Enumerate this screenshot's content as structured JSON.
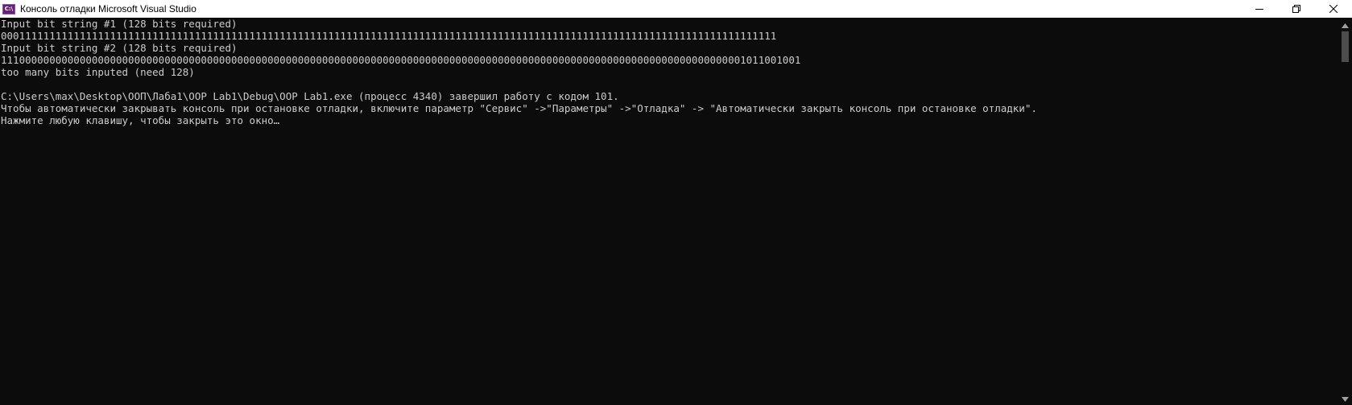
{
  "window": {
    "icon_label": "C:\\",
    "title": "Консоль отладки Microsoft Visual Studio",
    "minimize_icon": "minimize-icon",
    "maximize_icon": "restore-icon",
    "close_icon": "close-icon"
  },
  "console": {
    "lines": [
      "Input bit string #1 (128 bits required)",
      "00011111111111111111111111111111111111111111111111111111111111111111111111111111111111111111111111111111111111111111111111111111",
      "Input bit string #2 (128 bits required)",
      "111000000000000000000000000000000000000000000000000000000000000000000000000000000000000000000000000000000000000000000000001011001001",
      "too many bits inputed (need 128)",
      "",
      "C:\\Users\\max\\Desktop\\ООП\\Лаба1\\OOP Lab1\\Debug\\OOP Lab1.exe (процесс 4340) завершил работу с кодом 101.",
      "Чтобы автоматически закрывать консоль при остановке отладки, включите параметр \"Сервис\" ->\"Параметры\" ->\"Отладка\" -> \"Автоматически закрыть консоль при остановке отладки\".",
      "Нажмите любую клавишу, чтобы закрыть это окно…"
    ]
  },
  "colors": {
    "console_bg": "#0c0c0c",
    "console_text": "#cccccc",
    "titlebar_bg": "#ffffff"
  }
}
